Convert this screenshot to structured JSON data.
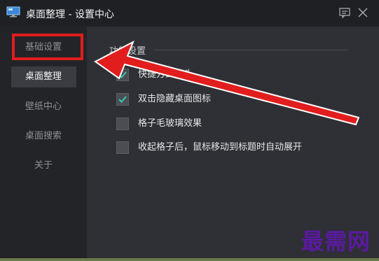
{
  "window": {
    "title": "桌面整理 - 设置中心",
    "icons": {
      "app": "monitor-icon",
      "feedback": "chat-icon",
      "close": "close-icon"
    }
  },
  "sidebar": {
    "items": [
      {
        "label": "基础设置",
        "active": false
      },
      {
        "label": "桌面整理",
        "active": true
      },
      {
        "label": "壁纸中心",
        "active": false
      },
      {
        "label": "桌面搜索",
        "active": false
      },
      {
        "label": "关于",
        "active": false
      }
    ]
  },
  "content": {
    "section_title": "功能设置",
    "options": [
      {
        "label": "快捷方式箭头",
        "checked": true
      },
      {
        "label": "双击隐藏桌面图标",
        "checked": true
      },
      {
        "label": "格子毛玻璃效果",
        "checked": false
      },
      {
        "label": "收起格子后，鼠标移动到标题时自动展开",
        "checked": false
      }
    ]
  },
  "annotation": {
    "color": "#e21d1d"
  },
  "watermark": {
    "text": "最需网",
    "color": "#5a1aa0"
  },
  "colors": {
    "accent_check": "#37c9b8",
    "titlebar": "#1f2024",
    "sidebar": "#232428",
    "content": "#2e3035"
  }
}
